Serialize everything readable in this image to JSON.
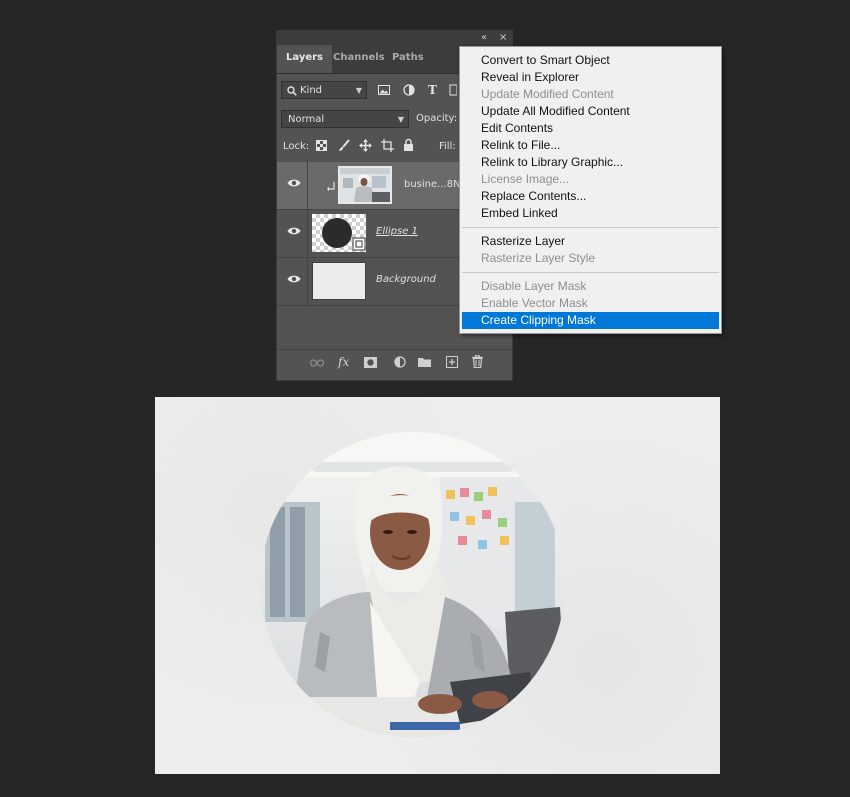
{
  "panel": {
    "collapse_glyph": "«",
    "close_glyph": "×",
    "tabs": [
      "Layers",
      "Channels",
      "Paths"
    ],
    "filter": {
      "icon": "search-icon",
      "value": "Kind"
    },
    "filter_icons": [
      "image-filter-icon",
      "adjustment-filter-icon",
      "type-filter-icon",
      "shape-filter-icon"
    ],
    "type_glyph": "T",
    "blend_mode": "Normal",
    "opacity_label": "Opacity:",
    "lock_label": "Lock:",
    "fill_label": "Fill:",
    "lock_icons": [
      "lock-transparent-icon",
      "lock-paint-icon",
      "lock-move-icon",
      "lock-artboard-icon",
      "lock-all-icon"
    ],
    "layers": [
      {
        "name": "busine...8NS",
        "type": "smart-object",
        "selected": true
      },
      {
        "name": "Ellipse 1",
        "type": "shape",
        "selected": false
      },
      {
        "name": "Background",
        "type": "background",
        "selected": false
      }
    ],
    "footer_icons": [
      "link-layers-icon",
      "fx-icon",
      "add-mask-icon",
      "adjustment-icon",
      "group-folder-icon",
      "new-layer-icon",
      "trash-icon"
    ],
    "fx_glyph": "fx"
  },
  "menu": {
    "items": [
      {
        "label": "Convert to Smart Object",
        "disabled": false
      },
      {
        "label": "Reveal in Explorer",
        "disabled": false
      },
      {
        "label": "Update Modified Content",
        "disabled": true
      },
      {
        "label": "Update All Modified Content",
        "disabled": false
      },
      {
        "label": "Edit Contents",
        "disabled": false
      },
      {
        "label": "Relink to File...",
        "disabled": false
      },
      {
        "label": "Relink to Library Graphic...",
        "disabled": false
      },
      {
        "label": "License Image...",
        "disabled": true
      },
      {
        "label": "Replace Contents...",
        "disabled": false
      },
      {
        "label": "Embed Linked",
        "disabled": false
      },
      {
        "label": "Rasterize Layer",
        "disabled": false
      },
      {
        "label": "Rasterize Layer Style",
        "disabled": true
      },
      {
        "label": "Disable Layer Mask",
        "disabled": true
      },
      {
        "label": "Enable Vector Mask",
        "disabled": true
      },
      {
        "label": "Create Clipping Mask",
        "disabled": false,
        "highlighted": true
      }
    ],
    "highlight_color": "#0078d7"
  },
  "canvas": {
    "background_color": "#ededed"
  }
}
